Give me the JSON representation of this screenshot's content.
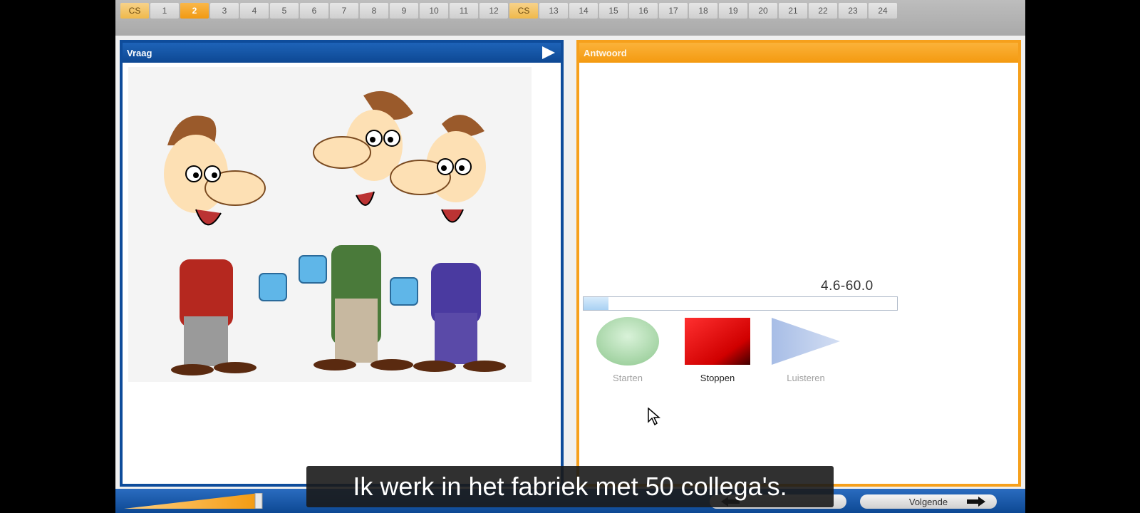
{
  "nav": {
    "items": [
      "CS",
      "1",
      "2",
      "3",
      "4",
      "5",
      "6",
      "7",
      "8",
      "9",
      "10",
      "11",
      "12",
      "CS",
      "13",
      "14",
      "15",
      "16",
      "17",
      "18",
      "19",
      "20",
      "21",
      "22",
      "23",
      "24"
    ],
    "active": "2"
  },
  "question": {
    "title": "Vraag"
  },
  "answer": {
    "title": "Antwoord",
    "timer": "4.6-60.0",
    "progress_fraction": 0.08,
    "controls": {
      "start_label": "Starten",
      "stop_label": "Stoppen",
      "listen_label": "Luisteren"
    }
  },
  "footer": {
    "next_label": "Volgende"
  },
  "subtitle": "Ik werk in het fabriek met 50 collega's.",
  "colors": {
    "question_border": "#0e4c9b",
    "answer_border": "#f6a01c",
    "active_tab": "#f19a12"
  }
}
